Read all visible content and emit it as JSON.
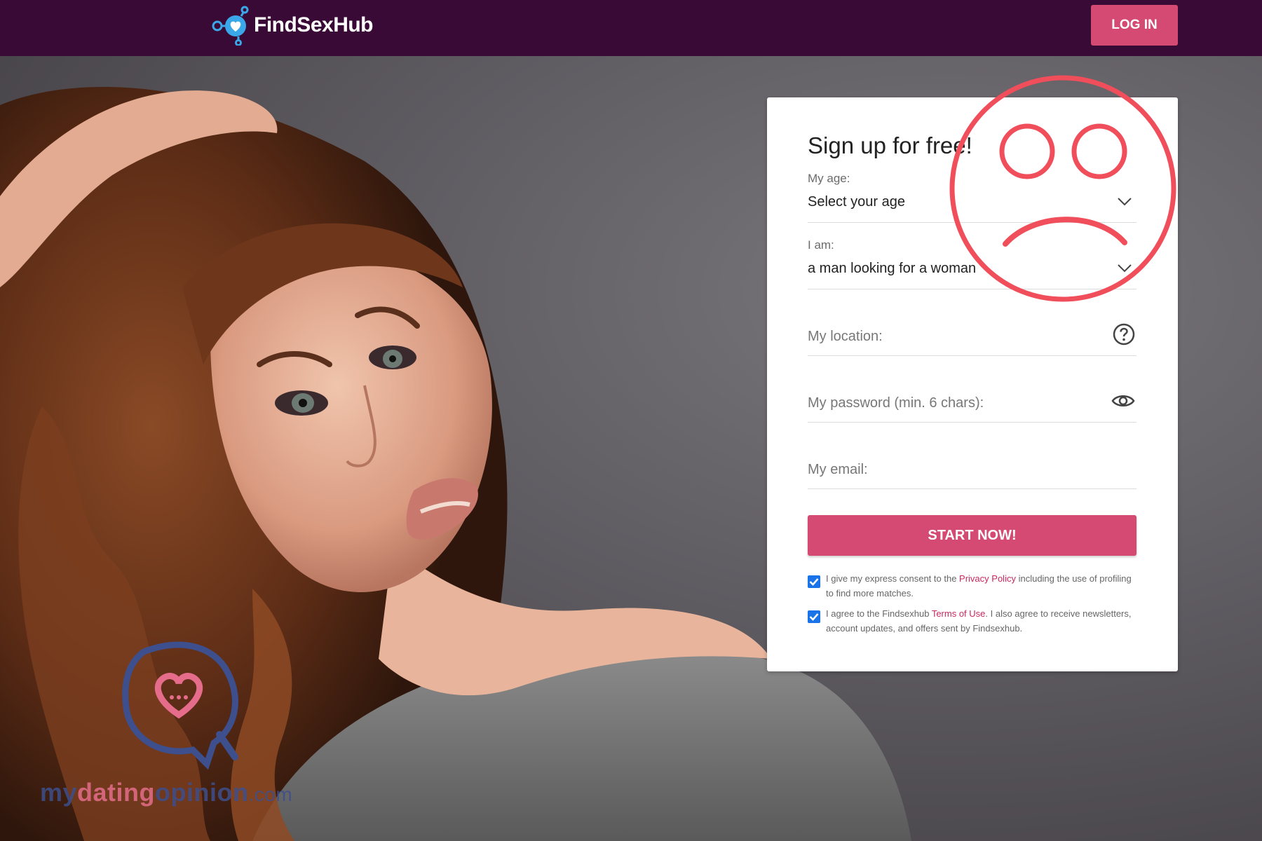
{
  "brand": {
    "name": "FindSexHub",
    "logo_icon": "heart-molecule-icon"
  },
  "header": {
    "login_label": "LOG IN"
  },
  "signup": {
    "title": "Sign up for free!",
    "age": {
      "label": "My age:",
      "value": "Select your age"
    },
    "gender": {
      "label": "I am:",
      "value": "a man looking for a woman"
    },
    "location": {
      "placeholder": "My location:"
    },
    "password": {
      "placeholder": "My password (min. 6 chars):"
    },
    "email": {
      "placeholder": "My email:"
    },
    "submit_label": "START NOW!",
    "consent_privacy": {
      "prefix": "I give my express consent to the ",
      "link": "Privacy Policy",
      "suffix": " including the use of profiling to find more matches.",
      "checked": true
    },
    "consent_terms": {
      "prefix": "I agree to the Findsexhub ",
      "link": "Terms of Use",
      "suffix": ". I also agree to receive newsletters, account updates, and offers sent by Findsexhub.",
      "checked": true
    }
  },
  "watermark": {
    "part1": "my",
    "part2": "dating",
    "part3": "opinion",
    "part4": ".com"
  },
  "colors": {
    "header_bg": "#3a0a36",
    "accent": "#d44a73",
    "link": "#c8285d",
    "sad_face": "#f04e5a"
  }
}
